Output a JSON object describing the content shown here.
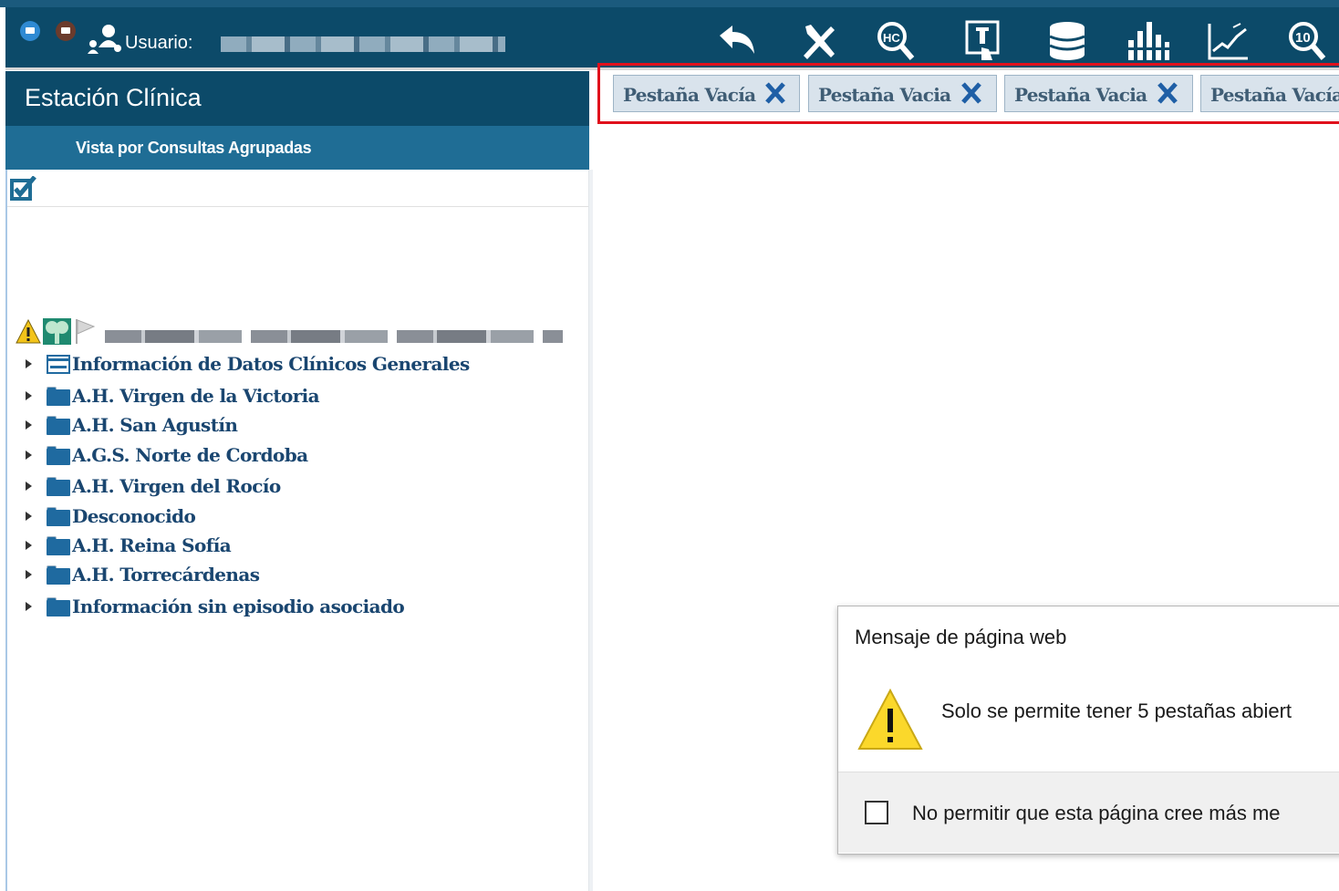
{
  "topbar": {
    "user_label": "Usuario:",
    "icons": [
      "mail-blue-icon",
      "mail-dark-icon",
      "users-icon",
      "back-icon",
      "tools-icon",
      "hc-search-icon",
      "document-touch-icon",
      "database-icon",
      "stats-icon",
      "chart-line-icon",
      "ten-search-icon"
    ]
  },
  "left_panel": {
    "title": "Estación Clínica",
    "view_label": "Vista por Consultas Agrupadas",
    "tree": [
      {
        "label": "Información de Datos Clínicos Generales",
        "icon": "card-icon"
      },
      {
        "label": "A.H. Virgen de la Victoria",
        "icon": "folder-icon"
      },
      {
        "label": "A.H. San Agustín",
        "icon": "folder-icon"
      },
      {
        "label": "A.G.S. Norte de Cordoba",
        "icon": "folder-icon"
      },
      {
        "label": "A.H. Virgen del Rocío",
        "icon": "folder-icon"
      },
      {
        "label": "Desconocido",
        "icon": "folder-icon"
      },
      {
        "label": "A.H. Reina Sofía",
        "icon": "folder-icon"
      },
      {
        "label": "A.H. Torrecárdenas",
        "icon": "folder-icon"
      },
      {
        "label": "Información sin episodio asociado",
        "icon": "folder-icon"
      }
    ]
  },
  "tabs": [
    {
      "label": "Pestaña Vacía"
    },
    {
      "label": "Pestaña Vacia"
    },
    {
      "label": "Pestaña Vacia"
    },
    {
      "label": "Pestaña Vacía"
    }
  ],
  "dialog": {
    "title": "Mensaje de página web",
    "message": "Solo se permite tener 5 pestañas abiert",
    "checkbox_label": "No permitir que esta página cree más me"
  },
  "colors": {
    "header": "#0c4a69",
    "subheader": "#1f6d95",
    "tab_bg": "#d9e3ec",
    "highlight": "#e0101c",
    "folder": "#1f6aa0"
  }
}
